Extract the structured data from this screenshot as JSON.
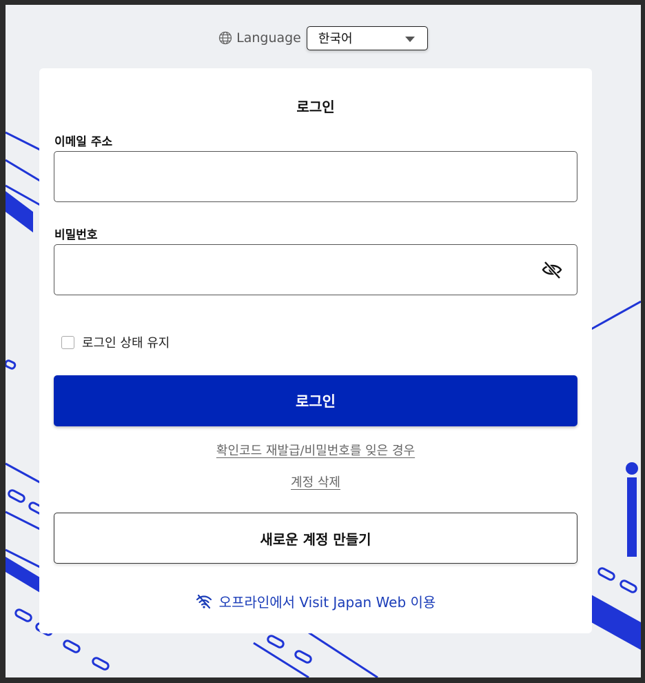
{
  "language": {
    "label": "Language",
    "selected": "한국어"
  },
  "login": {
    "title": "로그인",
    "email_label": "이메일 주소",
    "email_value": "",
    "password_label": "비밀번호",
    "password_value": "",
    "remember_label": "로그인 상태 유지",
    "remember_checked": false,
    "submit_label": "로그인",
    "forgot_link": "확인코드 재발급/비밀번호를 잊은 경우",
    "delete_link": "계정 삭제",
    "create_account_label": "새로운 계정 만들기",
    "offline_link": "오프라인에서 Visit Japan Web 이용"
  },
  "colors": {
    "primary": "#0025b8",
    "link_blue": "#1a3cb8",
    "background": "#eef0f3",
    "illustration": "#1f35d6"
  },
  "icons": {
    "language": "globe-icon",
    "dropdown": "caret-down-icon",
    "password_toggle": "eye-off-icon",
    "offline": "wifi-off-icon"
  }
}
